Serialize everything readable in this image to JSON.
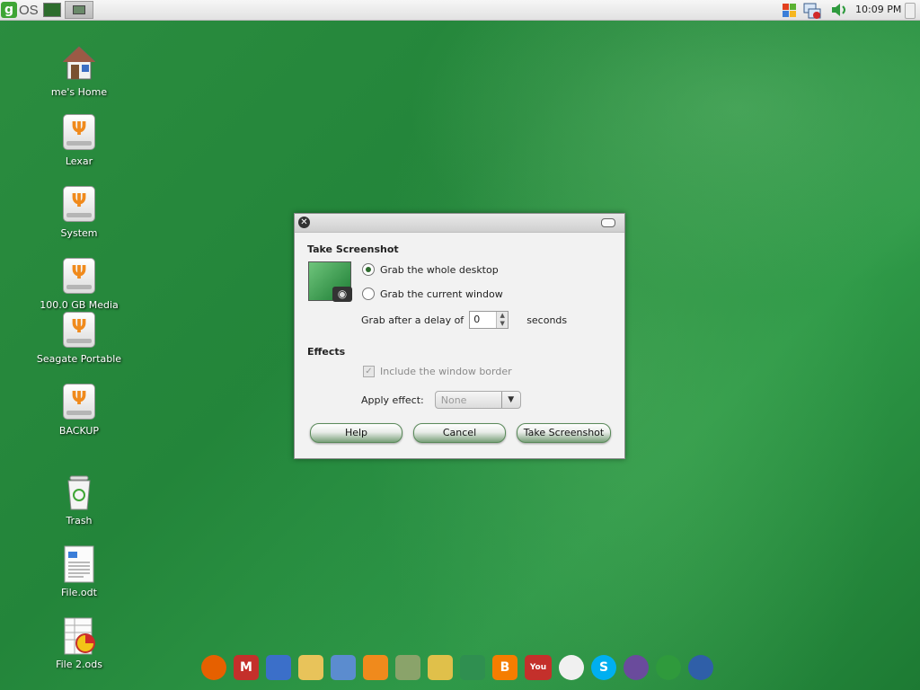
{
  "top_panel": {
    "logo_letter": "g",
    "logo_text": "OS",
    "clock": "10:09 PM",
    "tray_icons": [
      "color-windows-icon",
      "network-disconnected-icon",
      "volume-icon"
    ]
  },
  "desktop_icons": [
    {
      "label": "me's Home",
      "icon": "home-icon"
    },
    {
      "label": "Lexar",
      "icon": "usb-drive-icon"
    },
    {
      "label": "System",
      "icon": "usb-drive-icon"
    },
    {
      "label": "100.0 GB Media",
      "icon": "usb-drive-icon"
    },
    {
      "label": "Seagate Portable",
      "icon": "usb-drive-icon"
    },
    {
      "label": "BACKUP",
      "icon": "usb-drive-icon"
    },
    {
      "label": "Trash",
      "icon": "trash-icon"
    },
    {
      "label": "File.odt",
      "icon": "document-icon"
    },
    {
      "label": "File 2.ods",
      "icon": "spreadsheet-icon"
    }
  ],
  "dialog": {
    "heading": "Take Screenshot",
    "options": {
      "whole_desktop": "Grab the whole desktop",
      "current_window": "Grab the current window",
      "selected": "whole_desktop"
    },
    "delay_label": "Grab after a delay of",
    "delay_value": "0",
    "delay_suffix": "seconds",
    "effects_heading": "Effects",
    "include_border_label": "Include the window border",
    "include_border_checked": true,
    "apply_effect_label": "Apply effect:",
    "effect_value": "None",
    "buttons": {
      "help": "Help",
      "cancel": "Cancel",
      "take": "Take Screenshot"
    }
  },
  "dock": [
    {
      "name": "firefox-icon",
      "glyph": "",
      "color": "#e66000"
    },
    {
      "name": "gmail-icon",
      "glyph": "M",
      "color": "#c4302b"
    },
    {
      "name": "calendar-icon",
      "glyph": "",
      "color": "#3b6fc9"
    },
    {
      "name": "edit-icon",
      "glyph": "",
      "color": "#e8c35a"
    },
    {
      "name": "tools-icon",
      "glyph": "",
      "color": "#5b8ccf"
    },
    {
      "name": "rss-icon",
      "glyph": "",
      "color": "#f08a1c"
    },
    {
      "name": "news-icon",
      "glyph": "",
      "color": "#8aa36a"
    },
    {
      "name": "shopping-bag-icon",
      "glyph": "",
      "color": "#e0c04a"
    },
    {
      "name": "photos-icon",
      "glyph": "",
      "color": "#2f8f50"
    },
    {
      "name": "blogger-icon",
      "glyph": "B",
      "color": "#f57d00"
    },
    {
      "name": "youtube-icon",
      "glyph": "You",
      "color": "#c4302b"
    },
    {
      "name": "chat-icon",
      "glyph": "",
      "color": "#f0f0f0"
    },
    {
      "name": "skype-icon",
      "glyph": "S",
      "color": "#00aff0"
    },
    {
      "name": "openoffice-icon",
      "glyph": "",
      "color": "#6a4b9c"
    },
    {
      "name": "openoffice-calc-icon",
      "glyph": "",
      "color": "#2f9a3c"
    },
    {
      "name": "openoffice-writer-icon",
      "glyph": "",
      "color": "#2f5fa8"
    }
  ]
}
